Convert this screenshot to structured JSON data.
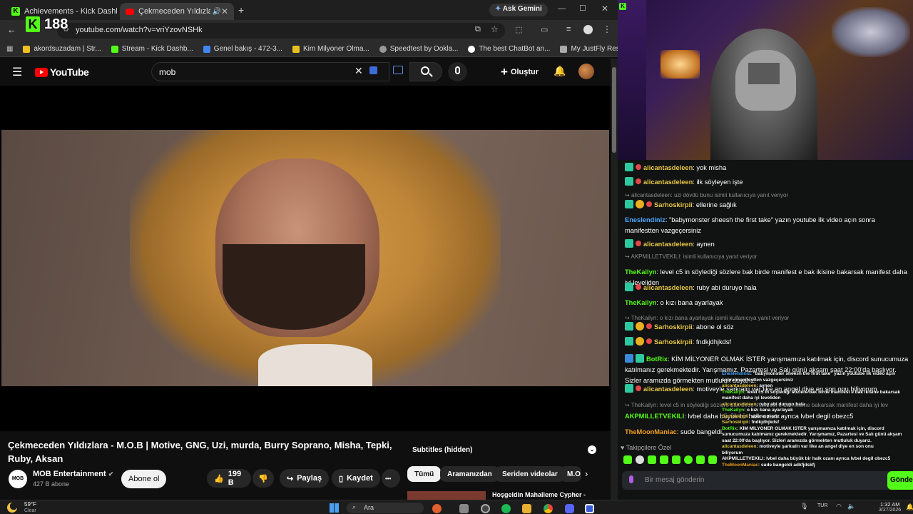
{
  "browser": {
    "tabs": [
      {
        "title": "Achievements - Kick Dashboard",
        "close": "✕"
      },
      {
        "title": "Çekmeceden Yıldızlara - M.O.B",
        "close": "✕"
      }
    ],
    "new_tab": "+",
    "ask_gemini": "Ask Gemini",
    "url": "youtube.com/watch?v=vriYzovNSHk",
    "bookmarks": [
      {
        "label": "akordsuzadam | Str...",
        "color": "#f0c020"
      },
      {
        "label": "Stream - Kick Dashb...",
        "color": "#53fc18"
      },
      {
        "label": "Genel bakış - 472-3...",
        "color": "#4285f4"
      },
      {
        "label": "Kim Milyoner Olma...",
        "color": "#e8c020"
      },
      {
        "label": "Speedtest by Ookla...",
        "color": "#999999"
      },
      {
        "label": "The best ChatBot an...",
        "color": "#ffffff"
      },
      {
        "label": "My JustFly Reservati...",
        "color": "#aaaaaa"
      }
    ]
  },
  "kick_counter": {
    "logo": "K",
    "value": "188"
  },
  "youtube": {
    "logo": "YouTube",
    "search_value": "mob",
    "create_label": "Oluştur",
    "video_title": "Çekmeceden Yıldızlara - M.O.B | Motive, GNG, Uzi, murda, Burry Soprano, Misha, Tepki, Ruby, Aksan",
    "channel": "MOB Entertainment",
    "channel_avatar": "MOB",
    "subscribers": "427 B abone",
    "subscribe": "Abone ol",
    "likes": "199 B",
    "share": "Paylaş",
    "save": "Kaydet",
    "more": "•••",
    "subtitles": "Subtitles (hidden)",
    "chips": [
      "Tümü",
      "Aramanızdan",
      "Seriden videolar",
      "M.O"
    ],
    "next_video": "Hoşgeldin Mahalleme Cypher -"
  },
  "chat": {
    "messages": [
      {
        "user": "alicantasdeleen",
        "text": "yok misha",
        "color": "#e8c846",
        "badges": [
          "sub",
          "gift"
        ]
      },
      {
        "user": "alicantasdeleen",
        "text": "ilk söyleyen işte",
        "color": "#e8c846",
        "badges": [
          "sub",
          "gift"
        ]
      },
      {
        "reply": "alicantasdeleen: uzi dövdü bunu isimli kullanıcıya yanıt veriyor"
      },
      {
        "user": "Sarhoskirpii",
        "text": "ellerine sağlık",
        "color": "#e8c846",
        "badges": [
          "sub",
          "gold",
          "gift"
        ]
      },
      {
        "user": "Eneslendiniz",
        "text": "\"babymonster sheesh the first take\" yazın youtube ilk video açın sonra manifestten vazgeçersiniz",
        "color": "#4aa8ff",
        "badges": []
      },
      {
        "user": "alicantasdeleen",
        "text": "aynen",
        "color": "#e8c846",
        "badges": [
          "sub",
          "gift"
        ]
      },
      {
        "reply": "AKPMILLETVEKILI: isimli kullanıcıya yanıt veriyor"
      },
      {
        "user": "TheKailyn",
        "text": "level c5 in söylediği sözlere bak birde manifest e bak ikisine bakarsak manifest daha iyi leveliden",
        "color": "#53fc18",
        "badges": []
      },
      {
        "user": "alicantasdeleen",
        "text": "ruby abi duruyo hala",
        "color": "#e8c846",
        "badges": [
          "sub",
          "gift"
        ]
      },
      {
        "user": "TheKailyn",
        "text": "o kızı bana ayarlayak",
        "color": "#53fc18",
        "badges": []
      },
      {
        "reply": "TheKailyn: o kızı bana ayarlayak isimli kullanıcıya yanıt veriyor"
      },
      {
        "user": "Sarhoskirpii",
        "text": "abone ol söz",
        "color": "#e8c846",
        "badges": [
          "sub",
          "gold",
          "gift"
        ]
      },
      {
        "user": "Sarhoskirpii",
        "text": "fndkjdhjkdsf",
        "color": "#e8c846",
        "badges": [
          "sub",
          "gold",
          "gift"
        ]
      },
      {
        "user": "BotRix",
        "text": "KİM MİLYONER OLMAK İSTER yarışmamıza katılmak için, discord sunucumuza katılmanız gerekmektedir. Yarışmamız, Pazartesi ve Salı günü akşam saat 22:00'da başlıyor. Sizler aramızda görmekten mutluluk duyarız.",
        "color": "#53fc18",
        "badges": [
          "bot",
          "sub"
        ]
      },
      {
        "user": "alicantasdeleen",
        "text": "motiveyle şarkıalrı var like an angel diye en son onu biliyorum",
        "color": "#e8c846",
        "badges": [
          "sub",
          "gift"
        ]
      },
      {
        "reply": "TheKailyn: level c5 in söylediği sözlere bak birde manifest e bak ikisine bakarsak manifest daha iyi lev"
      },
      {
        "user": "AKPMILLETVEKILI",
        "text": "lvbel daha büyük bir halk ozanı ayrıca lvbel degil obezc5",
        "color": "#53fc18",
        "badges": []
      },
      {
        "user": "TheMoonManiac",
        "text": "sude bangeldi",
        "color": "#f0a020",
        "badges": []
      }
    ],
    "followers_only": "Takipçilere Özel",
    "input_placeholder": "Bir mesaj gönderin",
    "send": "Gönder"
  },
  "minichat": [
    {
      "user": "Eneslendiniz",
      "text": ": \"babymonster sheesh the first take\" yazın youtube ilk video açın",
      "color": "#4aa8ff"
    },
    {
      "user": "",
      "text": "sonra manifestten vazgeçersiniz",
      "color": "#ffffff"
    },
    {
      "user": "alicantasdeleen",
      "text": ": aynen",
      "color": "#e8c846"
    },
    {
      "user": "TheKailyn",
      "text": ": level c5 in söylediği sözlere bak birde manifest e bak ikisine bakarsak",
      "color": "#53fc18"
    },
    {
      "user": "",
      "text": "manifest daha iyi leveliden",
      "color": "#ffffff"
    },
    {
      "user": "alicantasdeleen",
      "text": ": ruby abi duruyo hala",
      "color": "#e8c846"
    },
    {
      "user": "TheKailyn",
      "text": ": o kızı bana ayarlayak",
      "color": "#53fc18"
    },
    {
      "user": "Sarhoskirpii",
      "text": ": abone ol söz",
      "color": "#e8c846"
    },
    {
      "user": "Sarhoskirpii",
      "text": ": fndkjdhjkdsf",
      "color": "#e8c846"
    },
    {
      "user": "BotRix",
      "text": ": KİM MİLYONER OLMAK İSTER yarışmamıza katılmak için, discord",
      "color": "#53fc18"
    },
    {
      "user": "",
      "text": "sunucumuza katılmanız gerekmektedir. Yarışmamız, Pazartesi ve Salı günü akşam",
      "color": "#ffffff"
    },
    {
      "user": "",
      "text": "saat 22:00'da başlıyor. Sizleri aramızda görmekten mutluluk duyarız.",
      "color": "#ffffff"
    },
    {
      "user": "alicantasdeleen",
      "text": ": motiveyle şarkıalrı var like an angel diye en son onu",
      "color": "#e8c846"
    },
    {
      "user": "",
      "text": "biliyorum",
      "color": "#ffffff"
    },
    {
      "user": "AKPMILLETVEKILI",
      "text": ": lvbel daha büyük bir halk ozanı ayrıca lvbel degil obezc5",
      "color": "#ffffff"
    },
    {
      "user": "TheMoonManiac",
      "text": ": sude bangeldi adkfjdskfj",
      "color": "#f0a020"
    }
  ],
  "taskbar": {
    "weather_temp": "59°F",
    "weather_desc": "Clear",
    "search": "Ara",
    "lang": "TUR",
    "time": "1:32 AM",
    "date": "3/27/2026"
  }
}
